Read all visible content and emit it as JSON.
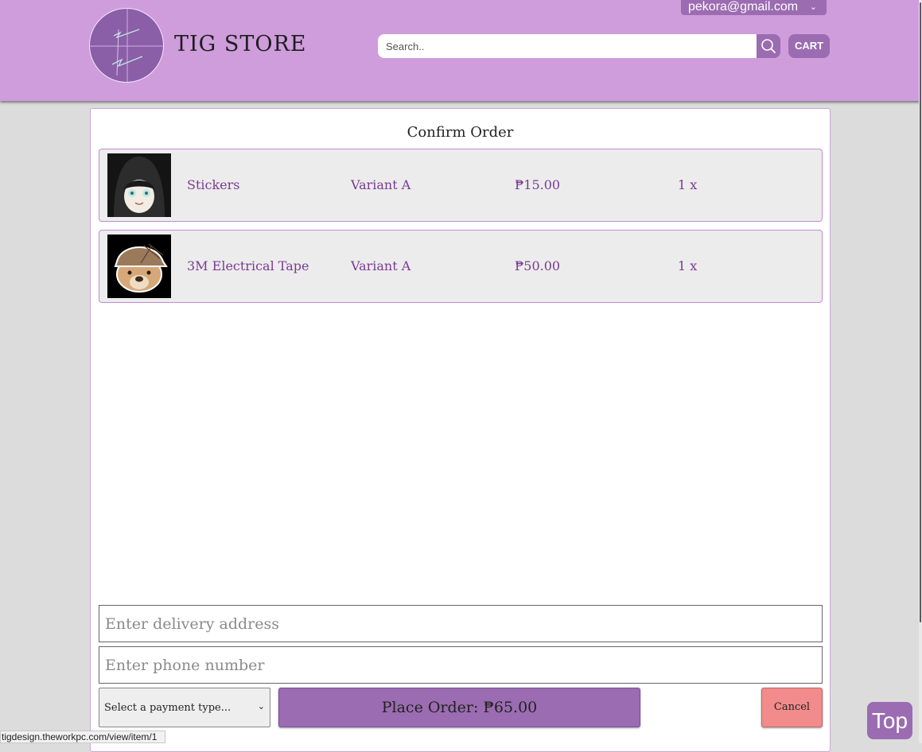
{
  "header": {
    "brand": "TIG STORE",
    "user_email": "pekora@gmail.com",
    "search_placeholder": "Search..",
    "cart_label": "CART"
  },
  "order": {
    "title": "Confirm Order",
    "items": [
      {
        "name": "Stickers",
        "variant": "Variant A",
        "price": "₱15.00",
        "qty": "1 x"
      },
      {
        "name": "3M Electrical Tape",
        "variant": "Variant A",
        "price": "₱50.00",
        "qty": "1 x"
      }
    ],
    "address_placeholder": "Enter delivery address",
    "phone_placeholder": "Enter phone number",
    "payment_select": "Select a payment type...",
    "place_order": "Place Order: ₱65.00",
    "cancel": "Cancel"
  },
  "status_url": "tigdesign.theworkpc.com/view/item/1",
  "top_button": "Top",
  "colors": {
    "header_bg": "#cf9ddb",
    "accent": "#9b6cb1",
    "item_text": "#7a3a92",
    "cancel_bg": "#f28b8b"
  },
  "icons": [
    "logo-icon",
    "chevron-down-icon",
    "search-icon"
  ]
}
